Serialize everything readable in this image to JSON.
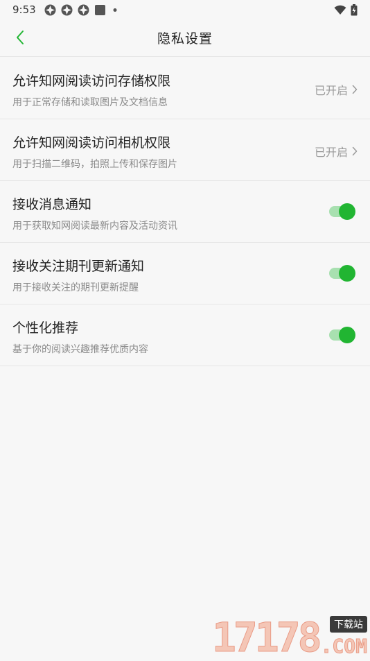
{
  "status_bar": {
    "time": "9:53",
    "icons_left": [
      "app-notification-icon",
      "app-notification-icon",
      "app-notification-icon",
      "square-icon",
      "dot-icon"
    ],
    "icons_right": [
      "wifi-icon",
      "battery-charging-icon"
    ]
  },
  "header": {
    "title": "隐私设置",
    "back_icon": "chevron-left-icon"
  },
  "colors": {
    "accent": "#21b532",
    "accent_light": "#a8e0b0",
    "background": "#f7f7f7",
    "divider": "#e6e6e6",
    "subtitle": "#8a8a8a"
  },
  "settings": [
    {
      "title": "允许知网阅读访问存储权限",
      "subtitle": "用于正常存储和读取图片及文档信息",
      "status": "已开启",
      "control": "link"
    },
    {
      "title": "允许知网阅读访问相机权限",
      "subtitle": "用于扫描二维码，拍照上传和保存图片",
      "status": "已开启",
      "control": "link"
    },
    {
      "title": "接收消息通知",
      "subtitle": "用于获取知网阅读最新内容及活动资讯",
      "enabled": true,
      "control": "toggle"
    },
    {
      "title": "接收关注期刊更新通知",
      "subtitle": "用于接收关注的期刊更新提醒",
      "enabled": true,
      "control": "toggle"
    },
    {
      "title": "个性化推荐",
      "subtitle": "基于你的阅读兴趣推荐优质内容",
      "enabled": true,
      "control": "toggle"
    }
  ],
  "watermark": {
    "digits": "17178",
    "tag": "下载站",
    "suffix": ".COM"
  }
}
